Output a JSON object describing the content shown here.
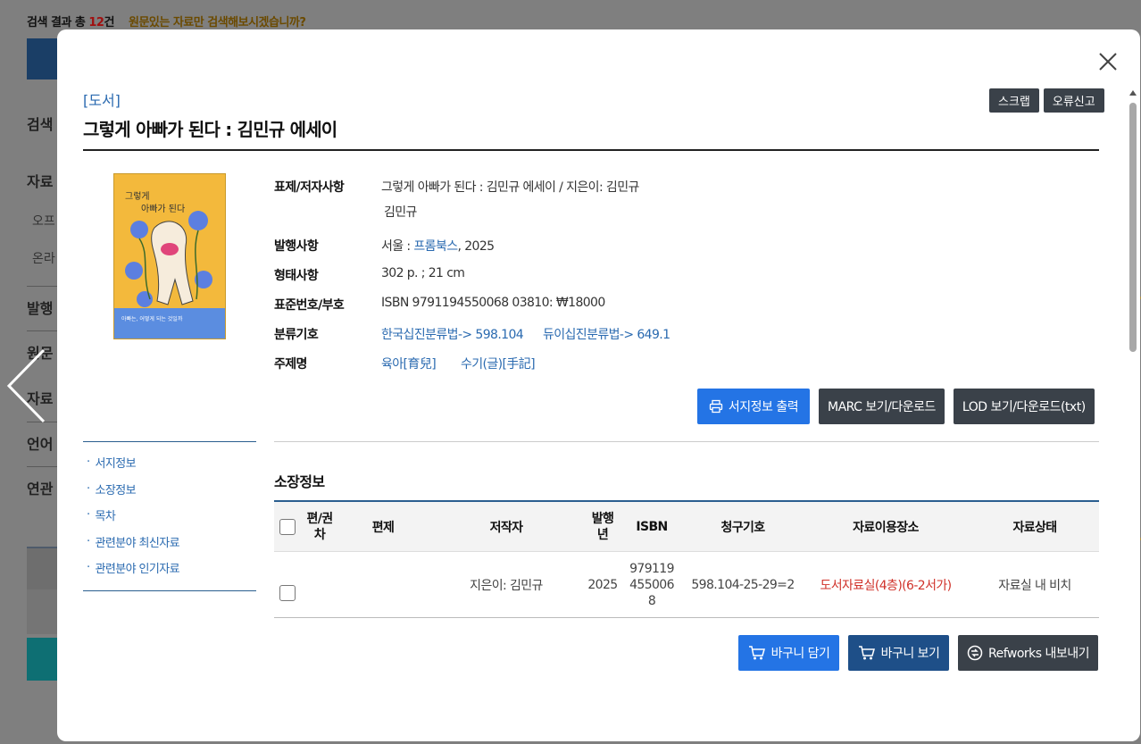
{
  "background": {
    "result_prefix": "검색 결과 총 ",
    "result_count": "12",
    "result_suffix": "건",
    "hint": "원문있는 자료만 검색해보시겠습니까?",
    "sidebar_items": [
      "검색",
      "자료",
      "발행",
      "원문",
      "자료",
      "언어",
      "연관"
    ],
    "sidebar_subs": [
      "오프",
      "온라"
    ],
    "bottom_text": "…"
  },
  "modal": {
    "category": "[도서]",
    "title": "그렇게 아빠가 된다 : 김민규 에세이",
    "top_buttons": {
      "scrap": "스크랩",
      "report": "오류신고"
    },
    "cover": {
      "title_line1": "그렇게",
      "title_line2": "아빠가 된다",
      "bottom_text": "아빠는, 어떻게 되는 것일까"
    },
    "info": {
      "title_author": {
        "label": "표제/저자사항",
        "value": "그렇게 아빠가 된다 : 김민규 에세이 / 지은이: 김민규",
        "value2": "김민규"
      },
      "publication": {
        "label": "발행사항",
        "prefix": "서울 : ",
        "publisher": "프롬북스",
        "suffix": ", 2025"
      },
      "physical": {
        "label": "형태사항",
        "value": "302 p. ; 21 cm"
      },
      "standard_no": {
        "label": "표준번호/부호",
        "value": "ISBN 9791194550068 03810: ₩18000"
      },
      "classification": {
        "label": "분류기호",
        "kdc": "한국십진분류법-> 598.104",
        "ddc": "듀이십진분류법-> 649.1"
      },
      "subject": {
        "label": "주제명",
        "s1": "육아[育兒]",
        "s2": "수기(글)[手記]"
      }
    },
    "action_buttons": {
      "print": "서지정보 출력",
      "marc": "MARC 보기/다운로드",
      "lod": "LOD 보기/다운로드(txt)"
    },
    "side_nav": [
      "서지정보",
      "소장정보",
      "목차",
      "관련분야 최신자료",
      "관련분야 인기자료"
    ],
    "holdings": {
      "title": "소장정보",
      "headers": {
        "vol1": "편/권",
        "vol2": "차",
        "subtitle": "편제",
        "author": "저작자",
        "year1": "발행",
        "year2": "년",
        "isbn": "ISBN",
        "call": "청구기호",
        "location": "자료이용장소",
        "status": "자료상태"
      },
      "rows": [
        {
          "vol": "",
          "subtitle": "",
          "author": "지은이: 김민규",
          "year": "2025",
          "isbn1": "979119",
          "isbn2": "455006",
          "isbn3": "8",
          "call": "598.104-25-29=2",
          "location": "도서자료실(4층)(6-2서가)",
          "status": "자료실 내 비치"
        }
      ]
    },
    "bottom_buttons": {
      "add_cart": "바구니 담기",
      "view_cart": "바구니 보기",
      "refworks": "Refworks 내보내기"
    }
  }
}
